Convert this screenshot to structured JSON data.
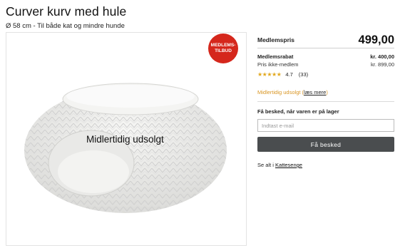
{
  "product": {
    "title": "Curver kurv med hule",
    "subtitle": "Ø 58 cm - Til både kat og mindre hunde",
    "badge": "MEDLEMS-TILBUD",
    "image_overlay": "Midlertidig udsolgt",
    "image_icon": "pet-bed-image"
  },
  "pricing": {
    "member_price_label": "Medlemspris",
    "member_price": "499,00",
    "member_discount_label": "Medlemsrabat",
    "member_discount": "kr. 400,00",
    "nonmember_label": "Pris ikke-medlem",
    "nonmember_price": "kr. 899,00"
  },
  "rating": {
    "stars": "★★★★★",
    "value": "4.7",
    "count": "(33)",
    "star_color": "#e2a91f"
  },
  "availability": {
    "status": "Midlertidig udsolgt",
    "more_link": "læs mere",
    "status_color": "#d99624"
  },
  "notify": {
    "label": "Få besked, når varen er på lager",
    "placeholder": "Indtast e-mail",
    "button": "Få besked"
  },
  "see_all": {
    "prefix": "Se alt i",
    "link": "Kattesenge"
  },
  "colors": {
    "badge": "#d5271c",
    "button": "#4a4d4f"
  }
}
